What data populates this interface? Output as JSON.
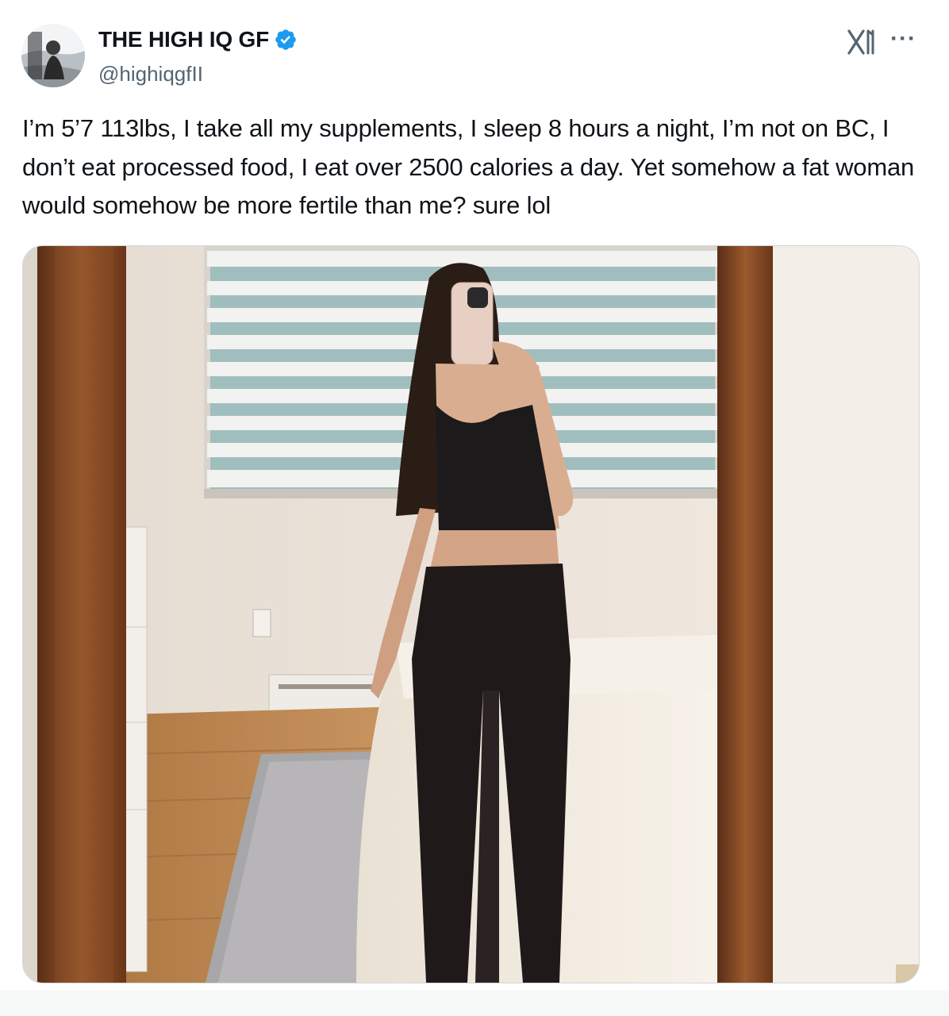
{
  "tweet": {
    "author": {
      "display_name": "THE HIGH IQ GF",
      "handle": "@highiqgfII",
      "verified": true,
      "verified_color": "#1d9bf0"
    },
    "text": "I’m 5’7 113lbs, I take all my supplements, I sleep 8 hours a night, I’m not on BC, I don’t eat processed food, I eat over 2500 calories a day. Yet somehow a fat woman would somehow be more fertile than me? sure lol",
    "more_label": "···"
  },
  "icons": {
    "verified": "verified-badge-icon",
    "platform_logo": "x-logo-icon",
    "more": "more-options-icon"
  }
}
